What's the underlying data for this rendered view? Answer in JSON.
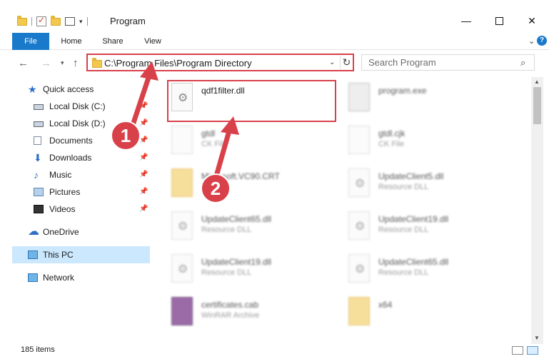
{
  "window": {
    "title": "Program",
    "minimize_glyph": "—",
    "close_glyph": "✕"
  },
  "ribbon": {
    "tabs": [
      "File",
      "Home",
      "Share",
      "View"
    ]
  },
  "address": {
    "path": "C:\\Program Files\\Program Directory",
    "search_placeholder": "Search Program"
  },
  "sidebar": {
    "items": [
      {
        "label": "Quick access",
        "icon": "star-icon"
      },
      {
        "label": "Local Disk (C:)",
        "icon": "drive-icon",
        "pinned": true
      },
      {
        "label": "Local Disk (D:)",
        "icon": "drive-icon",
        "pinned": true
      },
      {
        "label": "Documents",
        "icon": "documents-icon",
        "pinned": true
      },
      {
        "label": "Downloads",
        "icon": "downloads-icon",
        "pinned": true
      },
      {
        "label": "Music",
        "icon": "music-icon",
        "pinned": true
      },
      {
        "label": "Pictures",
        "icon": "pictures-icon",
        "pinned": true
      },
      {
        "label": "Videos",
        "icon": "videos-icon",
        "pinned": true
      },
      {
        "label": "OneDrive",
        "icon": "cloud-icon"
      },
      {
        "label": "This PC",
        "icon": "pc-icon",
        "selected": true
      },
      {
        "label": "Network",
        "icon": "network-icon"
      }
    ]
  },
  "files": [
    {
      "name": "qdf1filter.dll",
      "type": "",
      "icon": "dll-file-icon",
      "highlighted": true
    },
    {
      "name": "program.exe",
      "type": "",
      "icon": "exe-file-icon"
    },
    {
      "name": "gtdl",
      "type": "CK File",
      "icon": "generic-file-icon"
    },
    {
      "name": "gtdl.cjk",
      "type": "CK File",
      "icon": "generic-file-icon"
    },
    {
      "name": "Microsoft.VC90.CRT",
      "type": "",
      "icon": "folder-icon"
    },
    {
      "name": "UpdateClient5.dll",
      "type": "Resource DLL",
      "icon": "dll-file-icon"
    },
    {
      "name": "UpdateClient65.dll",
      "type": "Resource DLL",
      "icon": "dll-file-icon"
    },
    {
      "name": "UpdateClient19.dll",
      "type": "Resource DLL",
      "icon": "dll-file-icon"
    },
    {
      "name": "UpdateClient19.dll",
      "type": "Resource DLL",
      "icon": "dll-file-icon"
    },
    {
      "name": "UpdateClient65.dll",
      "type": "Resource DLL",
      "icon": "dll-file-icon"
    },
    {
      "name": "certificates.cab",
      "type": "WinRAR Archive",
      "icon": "archive-icon"
    },
    {
      "name": "x64",
      "type": "",
      "icon": "folder-icon"
    }
  ],
  "status": {
    "item_count": "185 items"
  },
  "annotations": {
    "step1": "1",
    "step2": "2",
    "color": "#d9414a"
  }
}
